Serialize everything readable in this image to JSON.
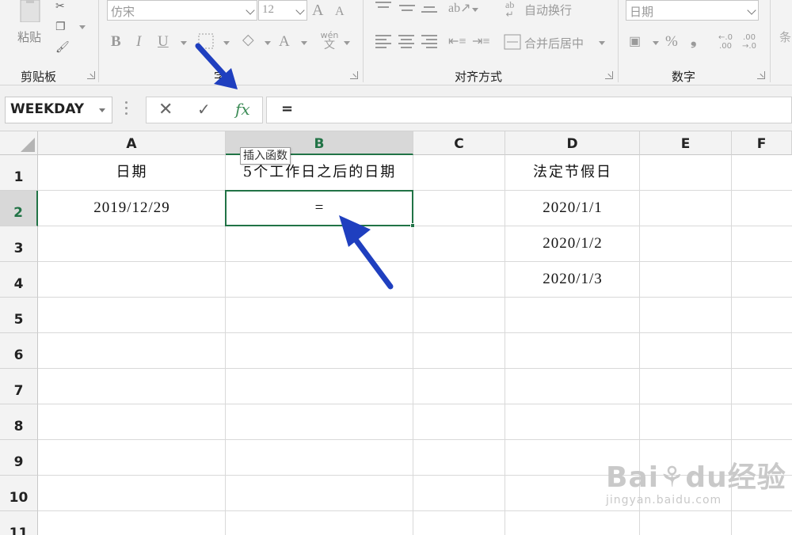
{
  "ribbon": {
    "clipboard": {
      "paste_label": "粘贴",
      "group_label": "剪贴板"
    },
    "font": {
      "font_name": "仿宋",
      "font_size": "12",
      "grow_label": "A",
      "shrink_label": "A",
      "bold_label": "B",
      "italic_label": "I",
      "underline_label": "U",
      "font_color_label": "A",
      "phonetic_top": "wén",
      "phonetic_bottom": "文",
      "group_label": "字"
    },
    "alignment": {
      "wrap_label": "自动换行",
      "merge_label": "合并后居中",
      "group_label": "对齐方式"
    },
    "number": {
      "format": "日期",
      "percent_label": "%",
      "comma_label": "❟",
      "inc_top": "←.0",
      "inc_bottom": ".00",
      "dec_top": ".00",
      "dec_bottom": "→.0",
      "group_label": "数字"
    },
    "styles_partial": "条"
  },
  "formula_bar": {
    "name_box": "WEEKDAY",
    "cancel": "✕",
    "enter": "✓",
    "fx": "fx",
    "formula": "="
  },
  "sheet": {
    "columns": [
      "A",
      "B",
      "C",
      "D",
      "E",
      "F"
    ],
    "rows": [
      "1",
      "2",
      "3",
      "4",
      "5",
      "6",
      "7",
      "8",
      "9",
      "10",
      "11"
    ],
    "cells": {
      "A1": "日期",
      "B1": "5个工作日之后的日期",
      "D1": "法定节假日",
      "A2": "2019/12/29",
      "B2": "=",
      "D2": "2020/1/1",
      "D3": "2020/1/2",
      "D4": "2020/1/3"
    },
    "tooltip": "插入函数",
    "active_cell": "B2"
  },
  "watermark": {
    "logo": "Bai⚘du经验",
    "url": "jingyan.baidu.com"
  },
  "colors": {
    "accent": "#217346",
    "arrow": "#1f3fbf",
    "fx_green": "#3d8c57"
  }
}
